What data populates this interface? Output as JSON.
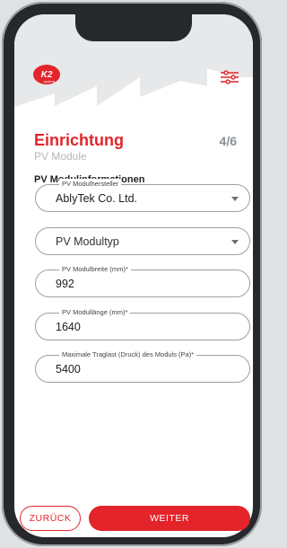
{
  "header": {
    "logo_text": "K2",
    "logo_subtext": "systems",
    "settings_icon": "sliders-icon"
  },
  "page": {
    "title": "Einrichtung",
    "step": "4/6",
    "subtitle": "PV Module",
    "section_title": "PV Modulinformationen"
  },
  "form": {
    "manufacturer": {
      "label": "PV Modulhersteller",
      "value": "AblyTek Co. Ltd."
    },
    "module_type": {
      "placeholder": "PV Modultyp"
    },
    "width": {
      "label": "PV Modulbreite (mm)*",
      "value": "992"
    },
    "length": {
      "label": "PV Modullänge (mm)*",
      "value": "1640"
    },
    "max_load": {
      "label": "Maximale Traglast (Druck) des Moduls (Pa)*",
      "value": "5400"
    }
  },
  "footer": {
    "back_label": "ZURÜCK",
    "next_label": "WEITER"
  },
  "colors": {
    "accent": "#e3242b",
    "header_gray": "#e6e8ea"
  }
}
